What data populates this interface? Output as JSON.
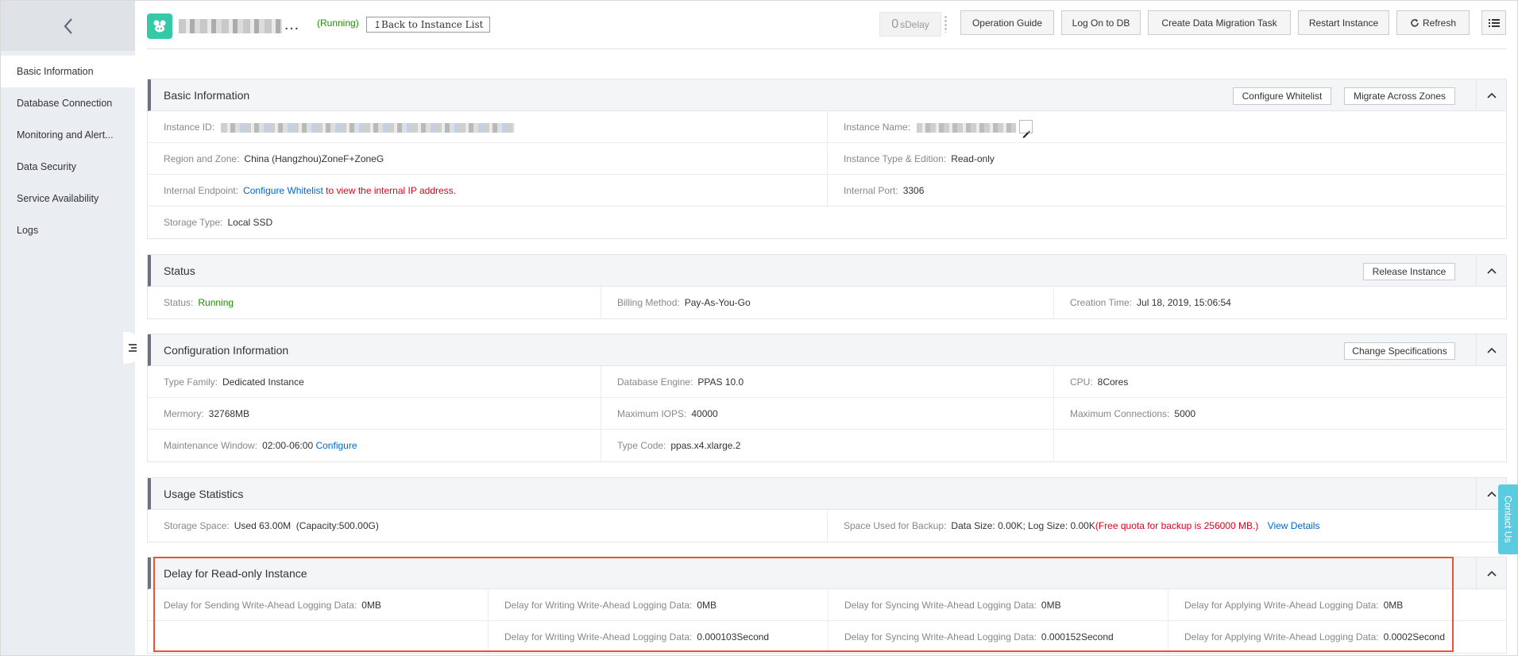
{
  "sidebar": {
    "items": [
      {
        "label": "Basic Information"
      },
      {
        "label": "Database Connection"
      },
      {
        "label": "Monitoring and Alert..."
      },
      {
        "label": "Data Security"
      },
      {
        "label": "Service Availability"
      },
      {
        "label": "Logs"
      }
    ]
  },
  "header": {
    "status": "(Running)",
    "back_label": "↥Back to Instance List",
    "delay_value": "0",
    "delay_unit": "sDelay",
    "buttons": {
      "operation_guide": "Operation Guide",
      "log_on": "Log On to DB",
      "migration": "Create Data Migration Task",
      "restart": "Restart Instance",
      "refresh": "Refresh"
    }
  },
  "basic": {
    "title": "Basic Information",
    "configure_whitelist": "Configure Whitelist",
    "migrate_zones": "Migrate Across Zones",
    "instance_id_label": "Instance ID:",
    "instance_name_label": "Instance Name:",
    "region_label": "Region and Zone:",
    "region_value": "China (Hangzhou)ZoneF+ZoneG",
    "type_label": "Instance Type & Edition:",
    "type_value": "Read-only",
    "endpoint_label": "Internal Endpoint:",
    "endpoint_link": "Configure Whitelist",
    "endpoint_text": " to view the internal IP address.",
    "port_label": "Internal Port:",
    "port_value": "3306",
    "storage_label": "Storage Type:",
    "storage_value": "Local SSD"
  },
  "status": {
    "title": "Status",
    "release": "Release Instance",
    "status_label": "Status:",
    "status_value": "Running",
    "billing_label": "Billing Method:",
    "billing_value": "Pay-As-You-Go",
    "created_label": "Creation Time:",
    "created_value": "Jul 18, 2019, 15:06:54"
  },
  "config": {
    "title": "Configuration Information",
    "change_spec": "Change Specifications",
    "family_label": "Type Family:",
    "family_value": "Dedicated Instance",
    "engine_label": "Database Engine:",
    "engine_value": "PPAS 10.0",
    "cpu_label": "CPU:",
    "cpu_value": "8Cores",
    "memory_label": "Mermory:",
    "memory_value": "32768MB",
    "iops_label": "Maximum IOPS:",
    "iops_value": "40000",
    "conn_label": "Maximum Connections:",
    "conn_value": "5000",
    "maint_label": "Maintenance Window:",
    "maint_value": "02:00-06:00",
    "maint_link": "Configure",
    "code_label": "Type Code:",
    "code_value": "ppas.x4.xlarge.2"
  },
  "usage": {
    "title": "Usage Statistics",
    "storage_label": "Storage Space:",
    "storage_value": "Used 63.00M  (Capacity:500.00G)",
    "backup_label": "Space Used for Backup:",
    "backup_value": "Data Size: 0.00K; Log Size: 0.00K",
    "backup_quota": "(Free quota for backup is 256000 MB.)",
    "view_details": "View Details"
  },
  "delay": {
    "title": "Delay for Read-only Instance",
    "send_label": "Delay for Sending Write-Ahead Logging Data:",
    "send_value": "0MB",
    "write_label": "Delay for Writing Write-Ahead Logging Data:",
    "write_value": "0MB",
    "sync_label": "Delay for Syncing Write-Ahead Logging Data:",
    "sync_value": "0MB",
    "apply_label": "Delay for Applying Write-Ahead Logging Data:",
    "apply_value": "0MB",
    "write_time": "0.000103Second",
    "sync_time": "0.000152Second",
    "apply_time": "0.0002Second"
  },
  "contact": "Contact Us"
}
